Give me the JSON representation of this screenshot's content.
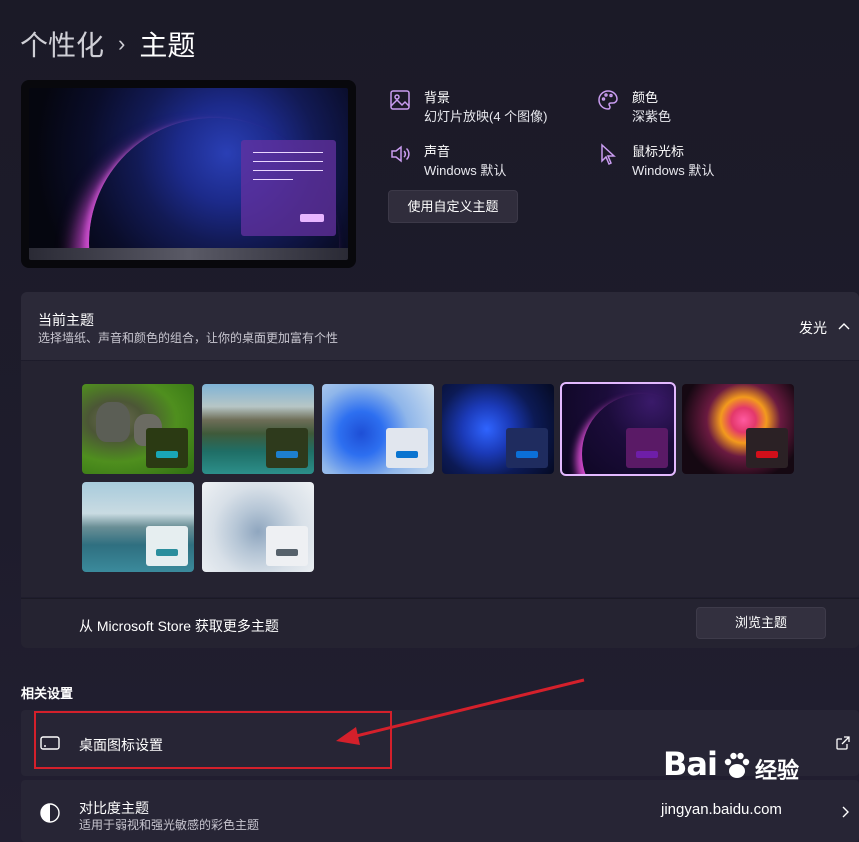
{
  "breadcrumb": {
    "parent": "个性化",
    "separator": "›",
    "current": "主题"
  },
  "info": {
    "background": {
      "label": "背景",
      "value": "幻灯片放映(4 个图像)"
    },
    "color": {
      "label": "颜色",
      "value": "深紫色"
    },
    "sound": {
      "label": "声音",
      "value": "Windows 默认"
    },
    "cursor": {
      "label": "鼠标光标",
      "value": "Windows 默认"
    },
    "custom_button": "使用自定义主题"
  },
  "current_theme": {
    "title": "当前主题",
    "subtitle": "选择墙纸、声音和颜色的组合，让你的桌面更加富有个性",
    "value": "发光",
    "themes": [
      {
        "name": "kittens",
        "swatch": "#2b3a13",
        "bar": "#19a6b6"
      },
      {
        "name": "lake-mountains",
        "swatch": "#2e3a1c",
        "bar": "#1d7fcf"
      },
      {
        "name": "bloom-light",
        "swatch": "#e1e6ee",
        "bar": "#0a74d0"
      },
      {
        "name": "bloom-dark",
        "swatch": "#1f2c5f",
        "bar": "#0b6fd8"
      },
      {
        "name": "glow",
        "swatch": "#5a1a66",
        "bar": "#6e1ea8",
        "selected": true
      },
      {
        "name": "captured-motion",
        "swatch": "#2b2125",
        "bar": "#d20f1a"
      },
      {
        "name": "sunrise",
        "swatch": "#e6eef0",
        "bar": "#2b8e9d"
      },
      {
        "name": "flow",
        "swatch": "#eef0f3",
        "bar": "#56616b"
      }
    ],
    "store_text": "从 Microsoft Store 获取更多主题",
    "browse_button": "浏览主题"
  },
  "related": {
    "title": "相关设置",
    "desktop_icons": "桌面图标设置",
    "contrast_title": "对比度主题",
    "contrast_sub": "适用于弱视和强光敏感的彩色主题"
  },
  "watermark": {
    "brand": "Bai",
    "cn": "经验",
    "url": "jingyan.baidu.com"
  },
  "colors": {
    "accent": "#c99cf0",
    "annotation": "#d4202b"
  }
}
